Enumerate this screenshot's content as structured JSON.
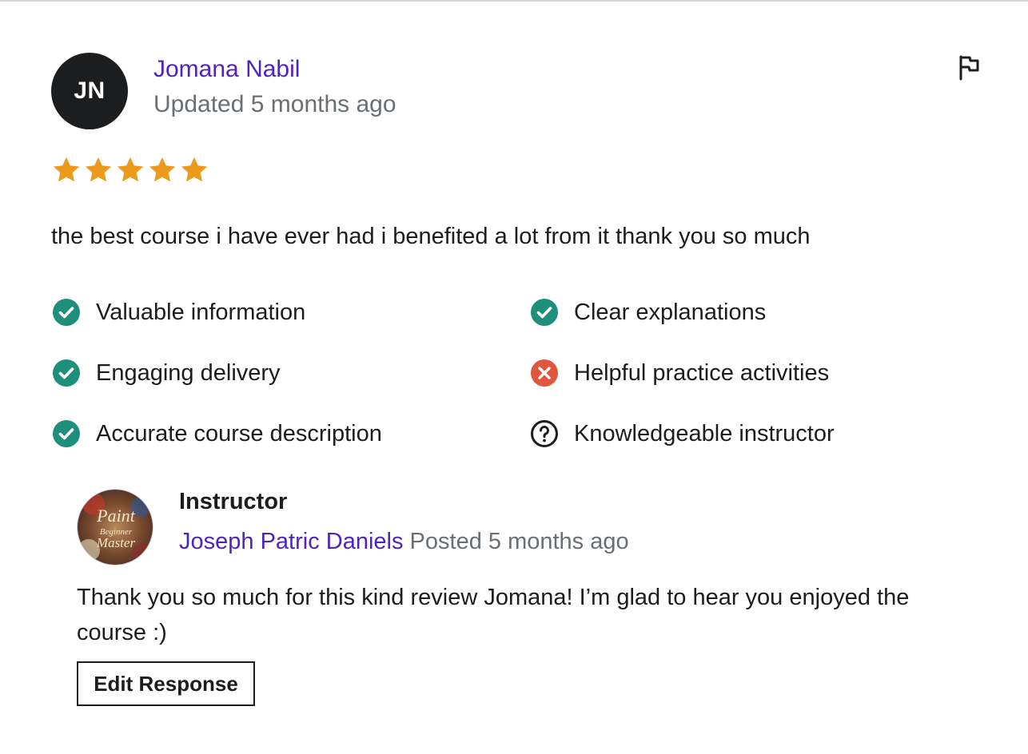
{
  "review": {
    "avatar_initials": "JN",
    "reviewer_name": "Jomana Nabil",
    "updated_time": "Updated 5 months ago",
    "rating": 5,
    "rating_max": 5,
    "star_color": "#eb9a1e",
    "text": "the best course i have ever had i benefited a lot from it thank you so much",
    "flag_icon": "flag-icon"
  },
  "criteria": [
    {
      "label": "Valuable information",
      "status": "yes",
      "icon": "check-circle-icon"
    },
    {
      "label": "Clear explanations",
      "status": "yes",
      "icon": "check-circle-icon"
    },
    {
      "label": "Engaging delivery",
      "status": "yes",
      "icon": "check-circle-icon"
    },
    {
      "label": "Helpful practice activities",
      "status": "no",
      "icon": "x-circle-icon"
    },
    {
      "label": "Accurate course description",
      "status": "yes",
      "icon": "check-circle-icon"
    },
    {
      "label": "Knowledgeable instructor",
      "status": "unsure",
      "icon": "question-circle-icon"
    }
  ],
  "colors": {
    "link_purple": "#5022c3",
    "check_green": "#1e8f7a",
    "x_red": "#e0553b",
    "muted_gray": "#6a6f73"
  },
  "response": {
    "role": "Instructor",
    "instructor_name": "Joseph Patric Daniels",
    "posted_time": "Posted 5 months ago",
    "avatar_logo_text": [
      "Paint",
      "Beginner",
      "Master"
    ],
    "text": "Thank you so much for this kind review Jomana! I’m glad to hear you enjoyed the course :)",
    "edit_button_label": "Edit Response"
  }
}
